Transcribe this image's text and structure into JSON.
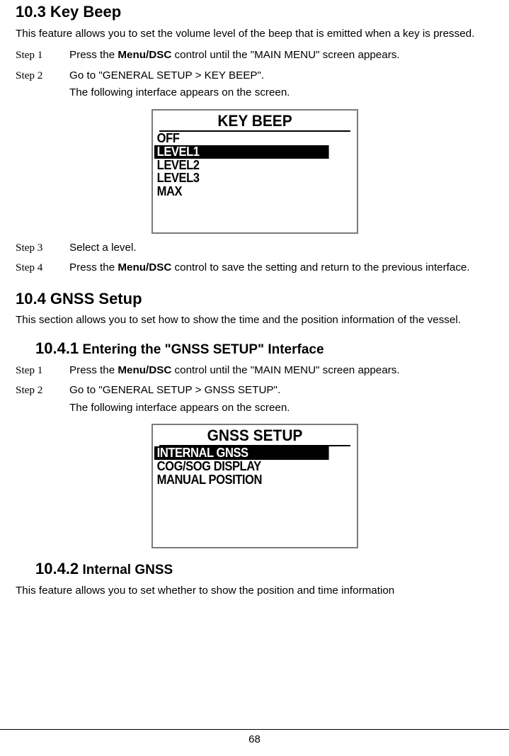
{
  "sec103": {
    "title": "10.3 Key Beep",
    "intro": "This feature allows you to set the volume level of the beep that is emitted when a key is pressed.",
    "step1_lbl": "Step 1",
    "step1a": "Press the ",
    "step1b": "Menu/DSC",
    "step1c": " control until the \"MAIN MENU\" screen appears.",
    "step2_lbl": "Step 2",
    "step2a": "Go to \"GENERAL SETUP > KEY BEEP\".",
    "step2b": "The following interface appears on the screen.",
    "step3_lbl": "Step 3",
    "step3a": "Select a level.",
    "step4_lbl": "Step 4",
    "step4a": "Press the ",
    "step4b": "Menu/DSC",
    "step4c": " control to save the setting and return to the previous interface."
  },
  "screen1": {
    "title": "KEY BEEP",
    "items": [
      "OFF",
      "LEVEL1",
      "LEVEL2",
      "LEVEL3",
      "MAX"
    ],
    "selected_index": 1
  },
  "sec104": {
    "title": "10.4 GNSS Setup",
    "intro": "This section allows you to set how to show the time and the position information of the vessel."
  },
  "sec1041": {
    "num": "10.4.1",
    "title": " Entering the \"GNSS SETUP\" Interface",
    "step1_lbl": "Step 1",
    "step1a": "Press the ",
    "step1b": "Menu/DSC",
    "step1c": " control until the \"MAIN MENU\" screen appears.",
    "step2_lbl": "Step 2",
    "step2a": "Go to \"GENERAL SETUP > GNSS SETUP\".",
    "step2b": "The following interface appears on the screen."
  },
  "screen2": {
    "title": "GNSS SETUP",
    "items": [
      "INTERNAL GNSS",
      "COG/SOG DISPLAY",
      "MANUAL POSITION"
    ],
    "selected_index": 0
  },
  "sec1042": {
    "num": "10.4.2",
    "title": " Internal GNSS",
    "intro": "This feature allows you to set whether to show the position and time information"
  },
  "page_num": "68"
}
